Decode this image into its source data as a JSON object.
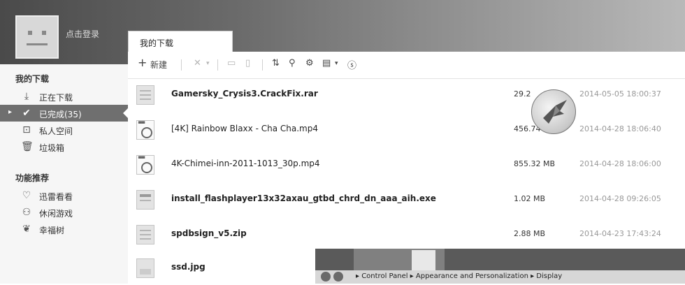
{
  "user": {
    "login_label": "点击登录"
  },
  "tab": {
    "label": "我的下载"
  },
  "sidebar": {
    "section1": "我的下载",
    "items": [
      {
        "label": "正在下载",
        "icon": "download-icon"
      },
      {
        "label": "已完成(35)",
        "icon": "check-icon",
        "active": true
      },
      {
        "label": "私人空间",
        "icon": "lock-icon"
      },
      {
        "label": "垃圾箱",
        "icon": "trash-icon"
      }
    ],
    "section2": "功能推荐",
    "features": [
      {
        "label": "迅雷看看",
        "icon": "heart-icon"
      },
      {
        "label": "休闲游戏",
        "icon": "gamepad-icon"
      },
      {
        "label": "幸福树",
        "icon": "leaf-icon"
      }
    ]
  },
  "toolbar": {
    "new_label": "新建"
  },
  "files": [
    {
      "name": "Gamersky_Crysis3.CrackFix.rar",
      "size": "29.2",
      "date": "2014-05-05 18:00:37",
      "type": "archive",
      "bold": true
    },
    {
      "name": "[4K] Rainbow Blaxx - Cha Cha.mp4",
      "size": "456.74 MB",
      "date": "2014-04-28 18:06:40",
      "type": "video",
      "bold": false
    },
    {
      "name": "4K-Chimei-inn-2011-1013_30p.mp4",
      "size": "855.32 MB",
      "date": "2014-04-28 18:06:00",
      "type": "video",
      "bold": false
    },
    {
      "name": "install_flashplayer13x32axau_gtbd_chrd_dn_aaa_aih.exe",
      "size": "1.02 MB",
      "date": "2014-04-28 09:26:05",
      "type": "exe",
      "bold": true
    },
    {
      "name": "spdbsign_v5.zip",
      "size": "2.88 MB",
      "date": "2014-04-23 17:43:24",
      "type": "archive",
      "bold": true
    },
    {
      "name": "ssd.jpg",
      "size": "",
      "date": "",
      "type": "image",
      "bold": true
    }
  ],
  "overlay": {
    "path": "▸ Control Panel ▸ Appearance and Personalization ▸ Display"
  }
}
